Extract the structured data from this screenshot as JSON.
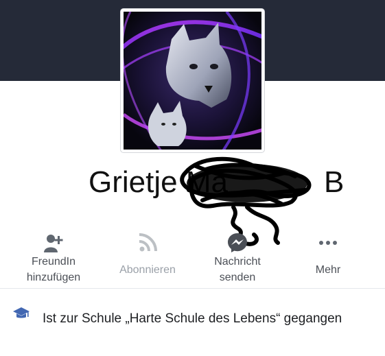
{
  "profile": {
    "name_visible": "Grietje Ma",
    "name_tail": "B",
    "avatar_description_icon": "wolf-avatar-image"
  },
  "actions": [
    {
      "line1": "FreundIn",
      "line2": "hinzufügen",
      "icon": "add-friend-icon",
      "enabled": true
    },
    {
      "line1": "Abonnieren",
      "line2": "",
      "icon": "rss-icon",
      "enabled": false
    },
    {
      "line1": "Nachricht",
      "line2": "senden",
      "icon": "messenger-icon",
      "enabled": true
    },
    {
      "line1": "Mehr",
      "line2": "",
      "icon": "more-dots-icon",
      "enabled": true
    }
  ],
  "info": {
    "education_text": "Ist zur Schule „Harte Schule des Lebens“ gegangen",
    "icon": "graduation-cap-icon"
  },
  "colors": {
    "cover": "#252a38",
    "icon_gray": "#606770",
    "icon_disabled": "#bcc0c4",
    "messenger": "#4b4f56"
  }
}
